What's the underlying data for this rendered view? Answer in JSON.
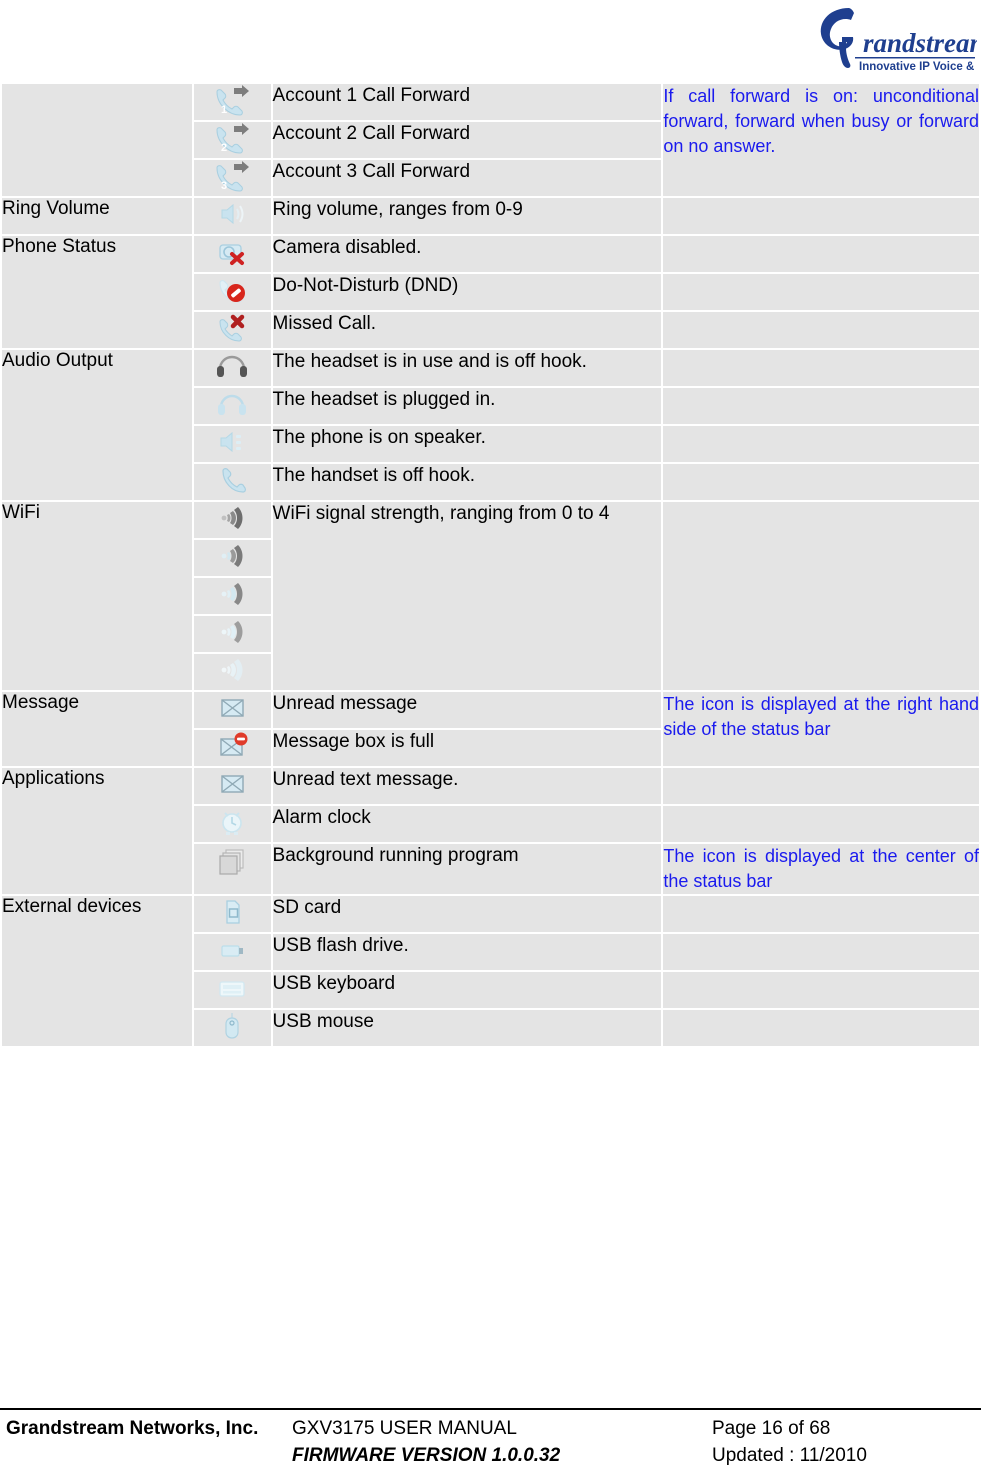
{
  "header": {
    "logo_name": "Grandstream",
    "logo_tagline": "Innovative IP Voice & Video"
  },
  "table": {
    "groups": [
      {
        "label": "",
        "note": "If call forward is on: unconditional forward, forward when busy or forward on no answer.",
        "note_rowspan": 3,
        "rows": [
          {
            "icon": "call-forward-1-icon",
            "description": "Account 1 Call Forward"
          },
          {
            "icon": "call-forward-2-icon",
            "description": "Account 2 Call Forward"
          },
          {
            "icon": "call-forward-3-icon",
            "description": "Account 3 Call Forward"
          }
        ]
      },
      {
        "label": "Ring Volume",
        "note": "",
        "note_rowspan": 1,
        "rows": [
          {
            "icon": "ring-volume-icon",
            "description": "Ring volume, ranges from 0-9"
          }
        ]
      },
      {
        "label": "Phone Status",
        "note": "",
        "note_rowspan": 0,
        "rows": [
          {
            "icon": "camera-disabled-icon",
            "description": "Camera disabled.",
            "note": ""
          },
          {
            "icon": "do-not-disturb-icon",
            "description": "Do-Not-Disturb (DND)",
            "note": ""
          },
          {
            "icon": "missed-call-icon",
            "description": "Missed Call.",
            "note": ""
          }
        ]
      },
      {
        "label": "Audio Output",
        "note": "",
        "note_rowspan": 0,
        "rows": [
          {
            "icon": "headset-in-use-icon",
            "description": "The headset is in use and is off hook.",
            "note": ""
          },
          {
            "icon": "headset-plugged-icon",
            "description": "The headset is plugged in.",
            "note": ""
          },
          {
            "icon": "speaker-icon",
            "description": "The phone is on speaker.",
            "note": ""
          },
          {
            "icon": "handset-off-hook-icon",
            "description": "The handset is off hook.",
            "note": ""
          }
        ]
      },
      {
        "label": "WiFi",
        "note": "",
        "note_rowspan": 5,
        "description": "WiFi signal strength, ranging from 0 to 4",
        "rows": [
          {
            "icon": "wifi-signal-4-icon"
          },
          {
            "icon": "wifi-signal-3-icon"
          },
          {
            "icon": "wifi-signal-2-icon"
          },
          {
            "icon": "wifi-signal-1-icon"
          },
          {
            "icon": "wifi-signal-0-icon"
          }
        ]
      },
      {
        "label": "Message",
        "note": "The icon is displayed at the right hand side of the status bar",
        "note_rowspan": 2,
        "rows": [
          {
            "icon": "unread-message-icon",
            "description": "Unread message"
          },
          {
            "icon": "message-box-full-icon",
            "description": "Message box is full"
          }
        ]
      },
      {
        "label": "Applications",
        "note": "",
        "note_rowspan": 0,
        "rows": [
          {
            "icon": "unread-text-message-icon",
            "description": "Unread text message.",
            "note": ""
          },
          {
            "icon": "alarm-clock-icon",
            "description": "Alarm clock",
            "note": ""
          },
          {
            "icon": "background-program-icon",
            "description": "Background running program",
            "note": "The icon is displayed at the center of the status bar"
          }
        ]
      },
      {
        "label": "External devices",
        "note": "",
        "note_rowspan": 0,
        "rows": [
          {
            "icon": "sd-card-icon",
            "description": "SD card",
            "note": ""
          },
          {
            "icon": "usb-flash-drive-icon",
            "description": "USB flash drive.",
            "note": ""
          },
          {
            "icon": "usb-keyboard-icon",
            "description": "USB keyboard",
            "note": ""
          },
          {
            "icon": "usb-mouse-icon",
            "description": "USB mouse",
            "note": ""
          }
        ]
      }
    ]
  },
  "footer": {
    "company": "Grandstream Networks, Inc.",
    "manual": "GXV3175 USER MANUAL",
    "firmware": "FIRMWARE VERSION 1.0.0.32",
    "page": "Page 16 of 68",
    "updated": "Updated : 11/2010"
  },
  "colors": {
    "cell_bg": "#e4e4e4",
    "note_text": "#1a1aee",
    "logo_blue": "#1f3f8f"
  }
}
